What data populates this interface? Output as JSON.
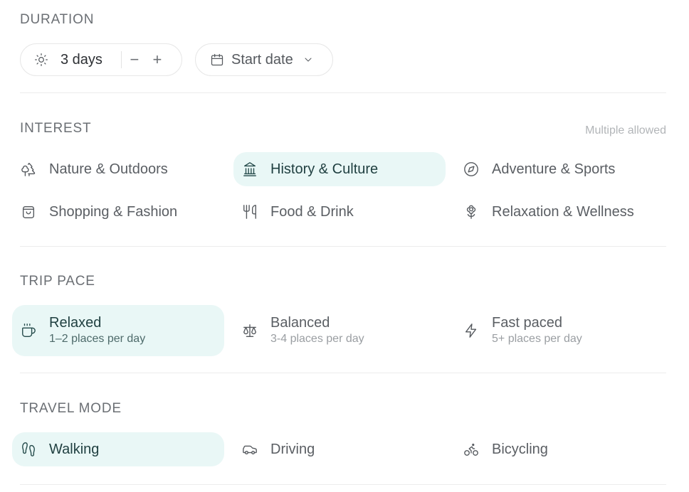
{
  "duration": {
    "title": "DURATION",
    "days_value": "3 days",
    "minus_label": "−",
    "plus_label": "+",
    "start_date_label": "Start date"
  },
  "interest": {
    "title": "INTEREST",
    "hint": "Multiple allowed",
    "options": [
      {
        "label": "Nature & Outdoors",
        "icon": "trees-icon",
        "selected": false
      },
      {
        "label": "History & Culture",
        "icon": "landmark-icon",
        "selected": true
      },
      {
        "label": "Adventure & Sports",
        "icon": "compass-icon",
        "selected": false
      },
      {
        "label": "Shopping & Fashion",
        "icon": "shopping-bag-icon",
        "selected": false
      },
      {
        "label": "Food & Drink",
        "icon": "utensils-icon",
        "selected": false
      },
      {
        "label": "Relaxation & Wellness",
        "icon": "flower-icon",
        "selected": false
      }
    ]
  },
  "trip_pace": {
    "title": "TRIP PACE",
    "options": [
      {
        "label": "Relaxed",
        "sub": "1–2 places per day",
        "icon": "coffee-icon",
        "selected": true
      },
      {
        "label": "Balanced",
        "sub": "3-4 places per day",
        "icon": "scale-icon",
        "selected": false
      },
      {
        "label": "Fast paced",
        "sub": "5+ places per day",
        "icon": "zap-icon",
        "selected": false
      }
    ]
  },
  "travel_mode": {
    "title": "TRAVEL MODE",
    "options": [
      {
        "label": "Walking",
        "icon": "footprints-icon",
        "selected": true
      },
      {
        "label": "Driving",
        "icon": "car-icon",
        "selected": false
      },
      {
        "label": "Bicycling",
        "icon": "bike-icon",
        "selected": false
      }
    ]
  },
  "colors": {
    "accent_bg": "#e9f7f6",
    "accent_text": "#1f3f40",
    "text": "#5a5e63",
    "muted": "#b2b5b8"
  }
}
